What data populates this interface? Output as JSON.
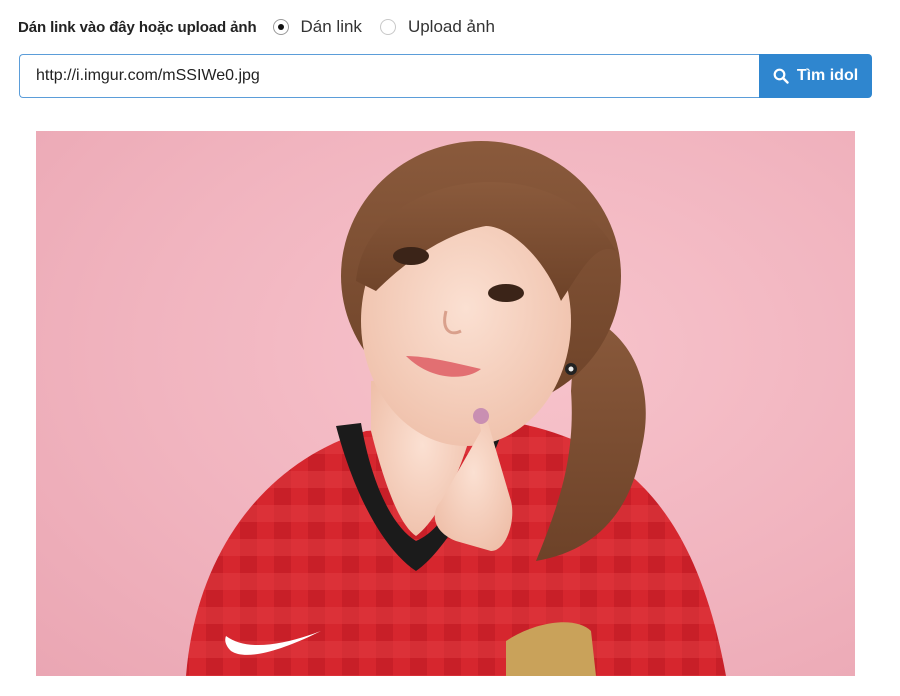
{
  "source_form": {
    "prompt_label": "Dán link vào đây hoặc upload ảnh",
    "options": [
      {
        "label": "Dán link",
        "selected": true
      },
      {
        "label": "Upload ảnh",
        "selected": false
      }
    ]
  },
  "search": {
    "url_value": "http://i.imgur.com/mSSIWe0.jpg",
    "button_label": "Tìm idol",
    "button_icon": "search-icon"
  },
  "colors": {
    "accent": "#2f86cf",
    "input_border": "#5b9dd9",
    "photo_background": "#f1b4bf"
  }
}
